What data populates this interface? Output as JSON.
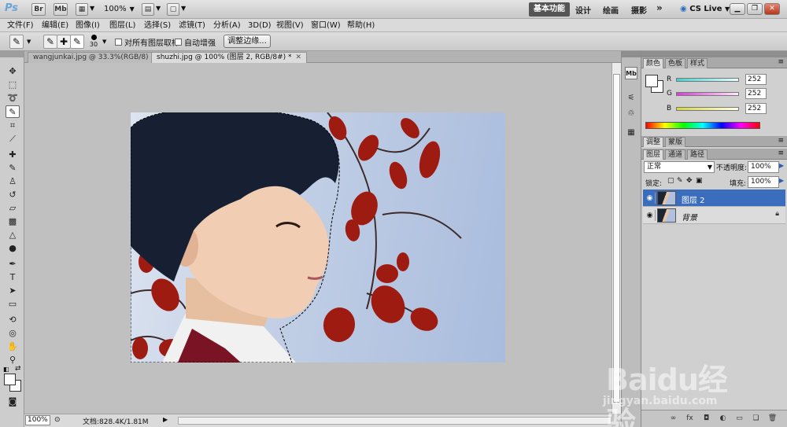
{
  "app": {
    "logo": "Ps",
    "bridge_icon": "Br",
    "minibridge_icon": "Mb",
    "zoom_level": "100%",
    "workspaces": [
      "基本功能",
      "设计",
      "绘画",
      "摄影"
    ],
    "more": "»",
    "cs_live": "CS Live"
  },
  "menu": [
    "文件(F)",
    "编辑(E)",
    "图像(I)",
    "图层(L)",
    "选择(S)",
    "滤镜(T)",
    "分析(A)",
    "3D(D)",
    "视图(V)",
    "窗口(W)",
    "帮助(H)"
  ],
  "options": {
    "brush_size": "30",
    "sample_all_layers": "对所有图层取样",
    "auto_enhance": "自动增强",
    "refine_edge_button": "调整边缘..."
  },
  "documents": {
    "tabs": [
      {
        "label": "wangjunkai.jpg @ 33.3%(RGB/8)",
        "active": false
      },
      {
        "label": "shuzhi.jpg @ 100% (图层 2, RGB/8#) *",
        "active": true
      }
    ]
  },
  "status": {
    "zoom": "100%",
    "doc_size": "文档:828.4K/1.81M"
  },
  "color_panel": {
    "tabs": [
      "颜色",
      "色板",
      "样式"
    ],
    "channels": [
      {
        "label": "R",
        "value": "252",
        "color": "#43d1d1"
      },
      {
        "label": "G",
        "value": "252",
        "color": "#d43fd4"
      },
      {
        "label": "B",
        "value": "252",
        "color": "#d7d73d"
      }
    ]
  },
  "adjust_panel": {
    "tabs": [
      "调整",
      "蒙版"
    ]
  },
  "layers_panel": {
    "tabs": [
      "图层",
      "通道",
      "路径"
    ],
    "blend_mode": "正常",
    "opacity_label": "不透明度:",
    "opacity_value": "100%",
    "lock_label": "锁定:",
    "fill_label": "填充:",
    "fill_value": "100%",
    "layers": [
      {
        "name": "图层 2",
        "selected": true,
        "locked": false
      },
      {
        "name": "背景",
        "selected": false,
        "locked": true
      }
    ]
  },
  "watermark": {
    "brand": "Baidu经验",
    "url": "jingyan.baidu.com"
  },
  "colors": {
    "selection_blue": "#3b6dbd",
    "workspace_gray": "#c0c0c0"
  }
}
